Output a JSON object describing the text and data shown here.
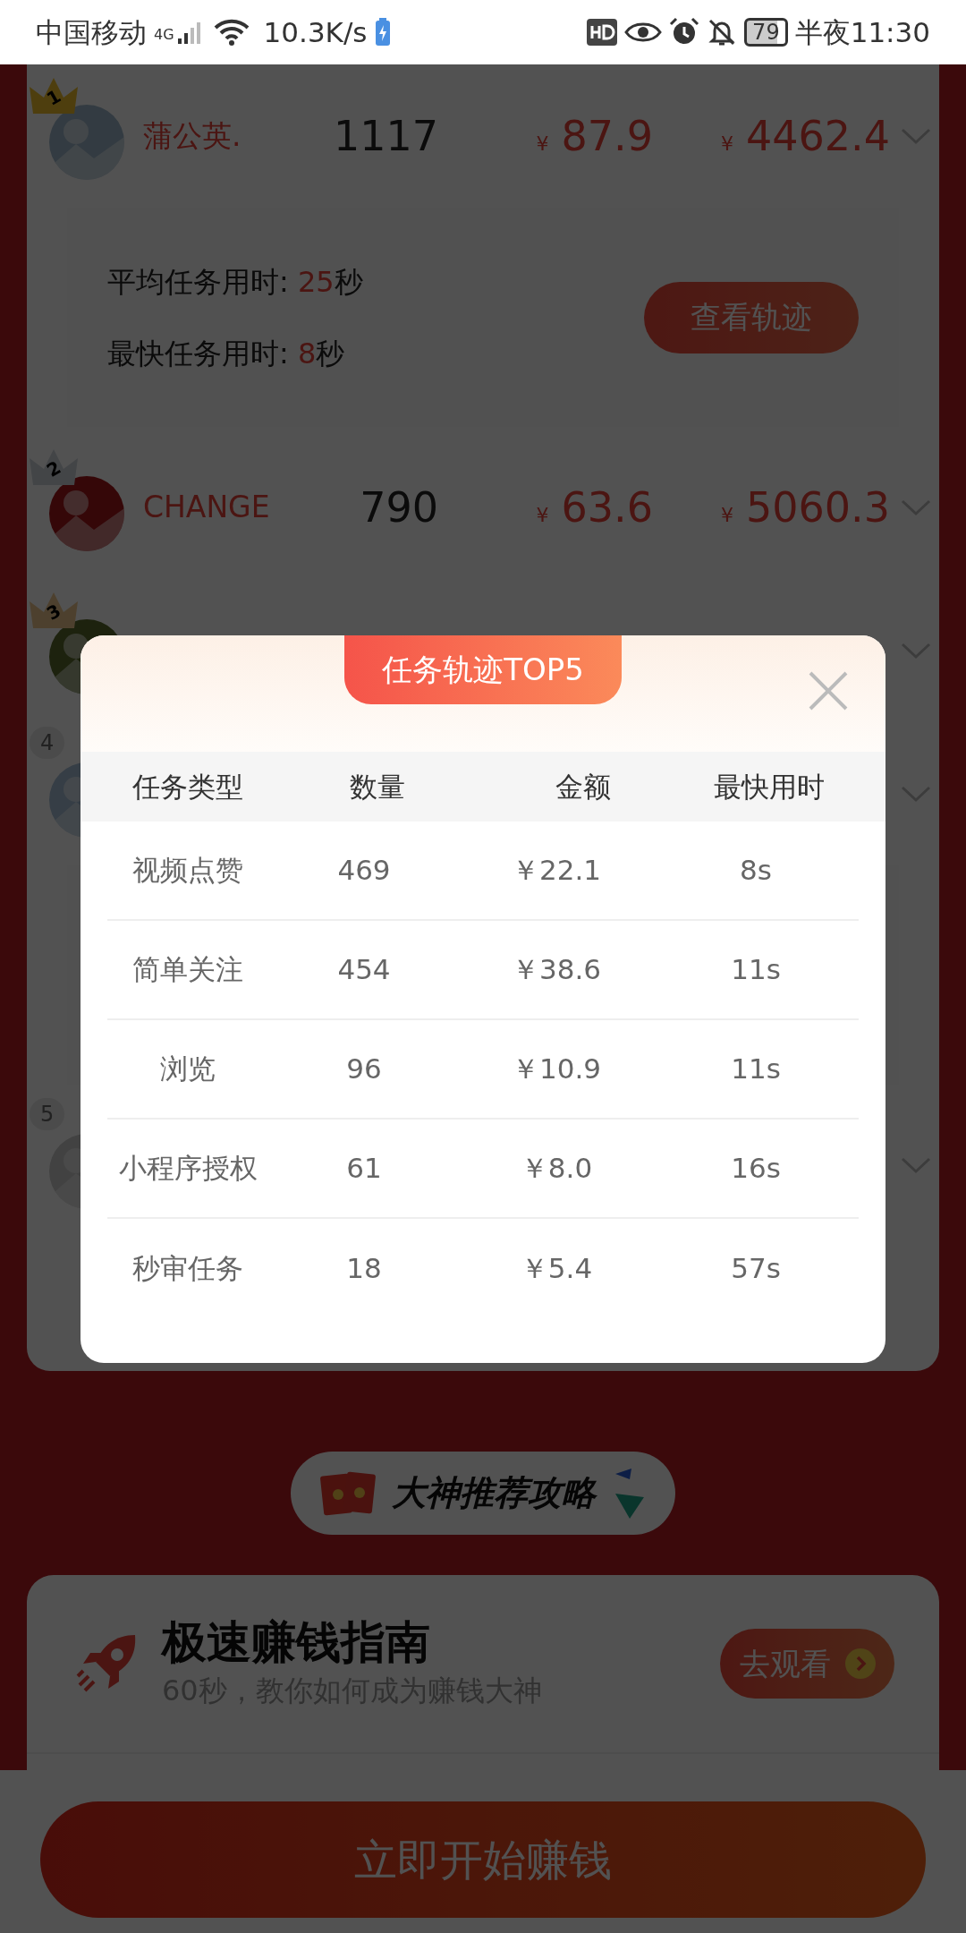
{
  "status_bar": {
    "carrier": "中国移动",
    "network": "4G",
    "speed": "10.3K/s",
    "battery": "79",
    "time": "半夜11:30"
  },
  "ranking": [
    {
      "rank": "1",
      "kind": "gold",
      "name": "蒲公英.",
      "count": "1117",
      "reward": {
        "currency": "¥",
        "value": "87.9"
      },
      "total": {
        "currency": "¥",
        "value": "4462.4"
      },
      "details": {
        "stats": [
          {
            "label": "平均任务用时: ",
            "value": "25",
            "unit": "秒"
          },
          {
            "label": "最快任务用时: ",
            "value": "8",
            "unit": "秒"
          }
        ],
        "button": "查看轨迹"
      }
    },
    {
      "rank": "2",
      "kind": "silver",
      "name": "CHANGE",
      "count": "790",
      "reward": {
        "currency": "¥",
        "value": "63.6"
      },
      "total": {
        "currency": "¥",
        "value": "5060.3"
      }
    },
    {
      "rank": "3",
      "kind": "bronze"
    },
    {
      "rank": "4",
      "kind": "plain"
    },
    {
      "rank": "5",
      "kind": "plain"
    }
  ],
  "modal": {
    "title": "任务轨迹TOP5",
    "columns": [
      "任务类型",
      "数量",
      "金额",
      "最快用时"
    ],
    "rows": [
      [
        "视频点赞",
        "469",
        "￥22.1",
        "8s"
      ],
      [
        "简单关注",
        "454",
        "￥38.6",
        "11s"
      ],
      [
        "浏览",
        "96",
        "￥10.9",
        "11s"
      ],
      [
        "小程序授权",
        "61",
        "￥8.0",
        "16s"
      ],
      [
        "秒审任务",
        "18",
        "￥5.4",
        "57s"
      ]
    ]
  },
  "strategy_banner": {
    "label": "大神推荐攻略"
  },
  "guide": {
    "title": "极速赚钱指南",
    "subtitle": "60秒，教你如何成为赚钱大神",
    "button": "去观看"
  },
  "cta": {
    "label": "立即开始赚钱"
  }
}
